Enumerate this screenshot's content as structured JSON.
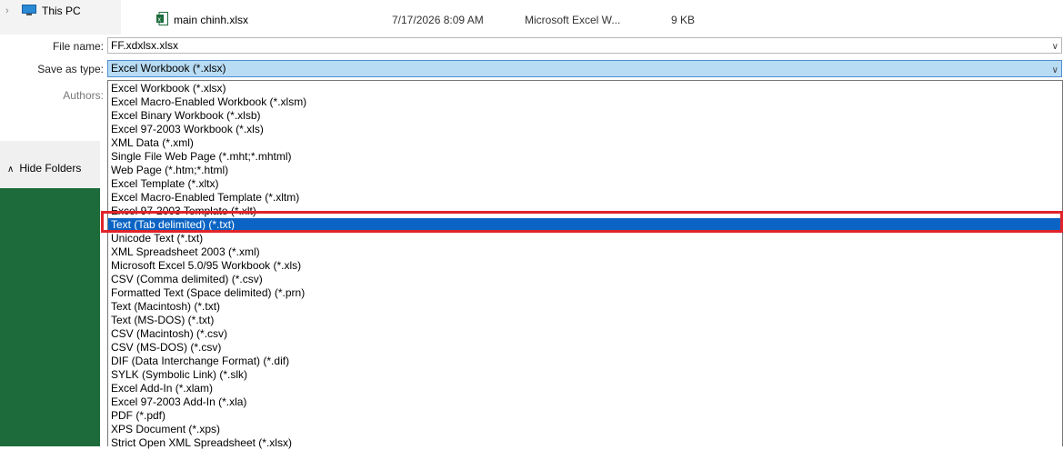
{
  "nav": {
    "this_pc": "This PC",
    "hide_folders": "Hide Folders"
  },
  "file": {
    "name": "main chinh.xlsx",
    "date": "7/17/2026 8:09 AM",
    "type": "Microsoft Excel W...",
    "size": "9 KB"
  },
  "form": {
    "filename_label": "File name:",
    "filename_value": "FF.xdxlsx.xlsx",
    "type_label": "Save as type:",
    "type_value": "Excel Workbook (*.xlsx)",
    "authors_label": "Authors:"
  },
  "options": [
    "Excel Workbook (*.xlsx)",
    "Excel Macro-Enabled Workbook (*.xlsm)",
    "Excel Binary Workbook (*.xlsb)",
    "Excel 97-2003 Workbook (*.xls)",
    "XML Data (*.xml)",
    "Single File Web Page (*.mht;*.mhtml)",
    "Web Page (*.htm;*.html)",
    "Excel Template (*.xltx)",
    "Excel Macro-Enabled Template (*.xltm)",
    "Excel 97-2003 Template (*.xlt)",
    "Text (Tab delimited) (*.txt)",
    "Unicode Text (*.txt)",
    "XML Spreadsheet 2003 (*.xml)",
    "Microsoft Excel 5.0/95 Workbook (*.xls)",
    "CSV (Comma delimited) (*.csv)",
    "Formatted Text (Space delimited) (*.prn)",
    "Text (Macintosh) (*.txt)",
    "Text (MS-DOS) (*.txt)",
    "CSV (Macintosh) (*.csv)",
    "CSV (MS-DOS) (*.csv)",
    "DIF (Data Interchange Format) (*.dif)",
    "SYLK (Symbolic Link) (*.slk)",
    "Excel Add-In (*.xlam)",
    "Excel 97-2003 Add-In (*.xla)",
    "PDF (*.pdf)",
    "XPS Document (*.xps)",
    "Strict Open XML Spreadsheet (*.xlsx)"
  ],
  "selected_option": "Text (Tab delimited) (*.txt)",
  "colors": {
    "selection": "#0b64c4",
    "highlight": "#e0242a",
    "excel_green": "#1d6b3b"
  }
}
